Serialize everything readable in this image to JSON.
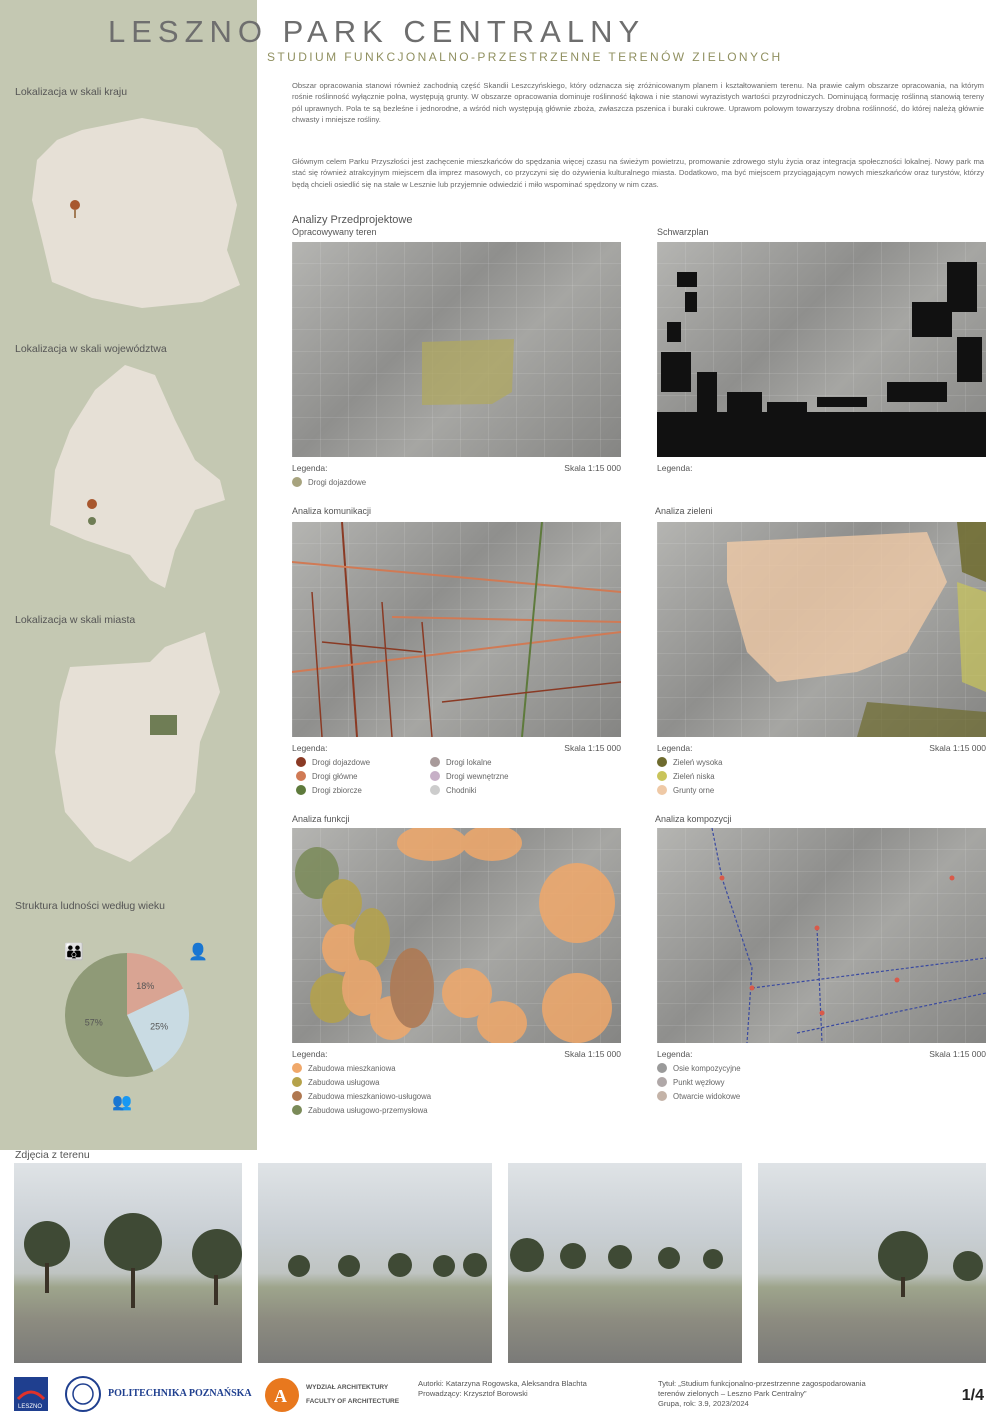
{
  "header": {
    "title": "LESZNO PARK CENTRALNY",
    "subtitle": "STUDIUM FUNKCJONALNO-PRZESTRZENNE TERENÓW ZIELONYCH"
  },
  "sidebar": {
    "loc_country": "Lokalizacja w skali kraju",
    "loc_voivodeship": "Lokalizacja w skali województwa",
    "loc_city": "Lokalizacja w skali miasta",
    "age_structure": "Struktura ludności według wieku",
    "pie": {
      "slices": [
        {
          "label": "18%",
          "value": 18,
          "color": "#d9a493"
        },
        {
          "label": "25%",
          "value": 25,
          "color": "#c9dbe3"
        },
        {
          "label": "57%",
          "value": 57,
          "color": "#8f9a77"
        }
      ]
    }
  },
  "intro": {
    "p1": "Obszar opracowania stanowi również zachodnią część Skandii Leszczyńskiego, który odznacza się zróżnicowanym planem i kształtowaniem terenu. Na prawie całym obszarze opracowania, na którym rośnie roślinność wyłącznie polna, występują grunty. W obszarze opracowania dominuje roślinność łąkowa i nie stanowi wyrazistych wartości przyrodniczych. Dominującą formację roślinną stanowią tereny pól uprawnych. Pola te są bezleśne i jednorodne, a wśród nich występują głównie zboża, zwłaszcza pszenica i buraki cukrowe. Uprawom polowym towarzyszy drobna roślinność, do której należą głównie chwasty i mniejsze rośliny.",
    "p2": "Głównym celem Parku Przyszłości jest zachęcenie mieszkańców do spędzania więcej czasu na świeżym powietrzu, promowanie zdrowego stylu życia oraz integracja społeczności lokalnej. Nowy park ma stać się również atrakcyjnym miejscem dla imprez masowych, co przyczyni się do ożywienia kulturalnego miasta. Dodatkowo, ma być miejscem przyciągającym nowych mieszkańców oraz turystów, którzy będą chcieli osiedlić się na stałe w Lesznie lub przyjemnie odwiedzić i miło wspominać spędzony w nim czas."
  },
  "analyses": {
    "heading": "Analizy Przedprojektowe",
    "p1": {
      "title": "Opracowywany teren",
      "legend": "Legenda:",
      "scale": "Skala 1:15 000",
      "items": [
        {
          "label": "Drogi dojazdowe",
          "color": "#a7a37e"
        }
      ]
    },
    "p2": {
      "title": "Schwarzplan",
      "legend": "Legenda:",
      "scale": "",
      "items": []
    },
    "p3": {
      "title": "Analiza komunikacji",
      "legend": "Legenda:",
      "scale": "Skala 1:15 000",
      "items": [
        {
          "label": "Drogi dojazdowe",
          "color": "#8a3a24"
        },
        {
          "label": "Drogi główne",
          "color": "#d07a55"
        },
        {
          "label": "Drogi zbiorcze",
          "color": "#5e7a3c"
        },
        {
          "label": "Drogi lokalne",
          "color": "#a89a9a"
        },
        {
          "label": "Drogi wewnętrzne",
          "color": "#c7b0c7"
        },
        {
          "label": "Chodniki",
          "color": "#cccccc"
        }
      ]
    },
    "p4": {
      "title": "Analiza zieleni",
      "legend": "Legenda:",
      "scale": "Skala 1:15 000",
      "items": [
        {
          "label": "Zieleń wysoka",
          "color": "#6e6b2e"
        },
        {
          "label": "Zieleń niska",
          "color": "#c9c45a"
        },
        {
          "label": "Grunty orne",
          "color": "#efc9a6"
        }
      ]
    },
    "p5": {
      "title": "Analiza funkcji",
      "legend": "Legenda:",
      "scale": "Skala 1:15 000",
      "items": [
        {
          "label": "Zabudowa mieszkaniowa",
          "color": "#f0a86a"
        },
        {
          "label": "Zabudowa usługowa",
          "color": "#b5a24a"
        },
        {
          "label": "Zabudowa mieszkaniowo-usługowa",
          "color": "#b07850"
        },
        {
          "label": "Zabudowa usługowo-przemysłowa",
          "color": "#7a8a58"
        }
      ]
    },
    "p6": {
      "title": "Analiza kompozycji",
      "legend": "Legenda:",
      "scale": "Skala 1:15 000",
      "items": [
        {
          "label": "Osie kompozycyjne",
          "color": "#9a9a9a"
        },
        {
          "label": "Punkt węzłowy",
          "color": "#b0a8a8"
        },
        {
          "label": "Otwarcie widokowe",
          "color": "#c4b3a8"
        }
      ]
    }
  },
  "photos": {
    "label": "Zdjęcia z terenu"
  },
  "footer": {
    "uni": "POLITECHNIKA POZNAŃSKA",
    "faculty1": "WYDZIAŁ ARCHITEKTURY",
    "faculty2": "FACULTY OF ARCHITECTURE",
    "authors": "Autorki: Katarzyna Rogowska, Aleksandra Blachta",
    "supervisor": "Prowadzący: Krzysztof Borowski",
    "title_line1": "Tytuł: „Studium funkcjonalno-przestrzenne zagospodarowania",
    "title_line2": "terenów zielonych – Leszno Park Centralny”",
    "group": "Grupa, rok: 3.9, 2023/2024",
    "page": "1/4",
    "leszno_logo": "LESZNO"
  },
  "colors": {
    "sidebar": "#c4c8b2",
    "accent": "#909060",
    "pin": "#a8572e",
    "park": "#6f7d55"
  }
}
